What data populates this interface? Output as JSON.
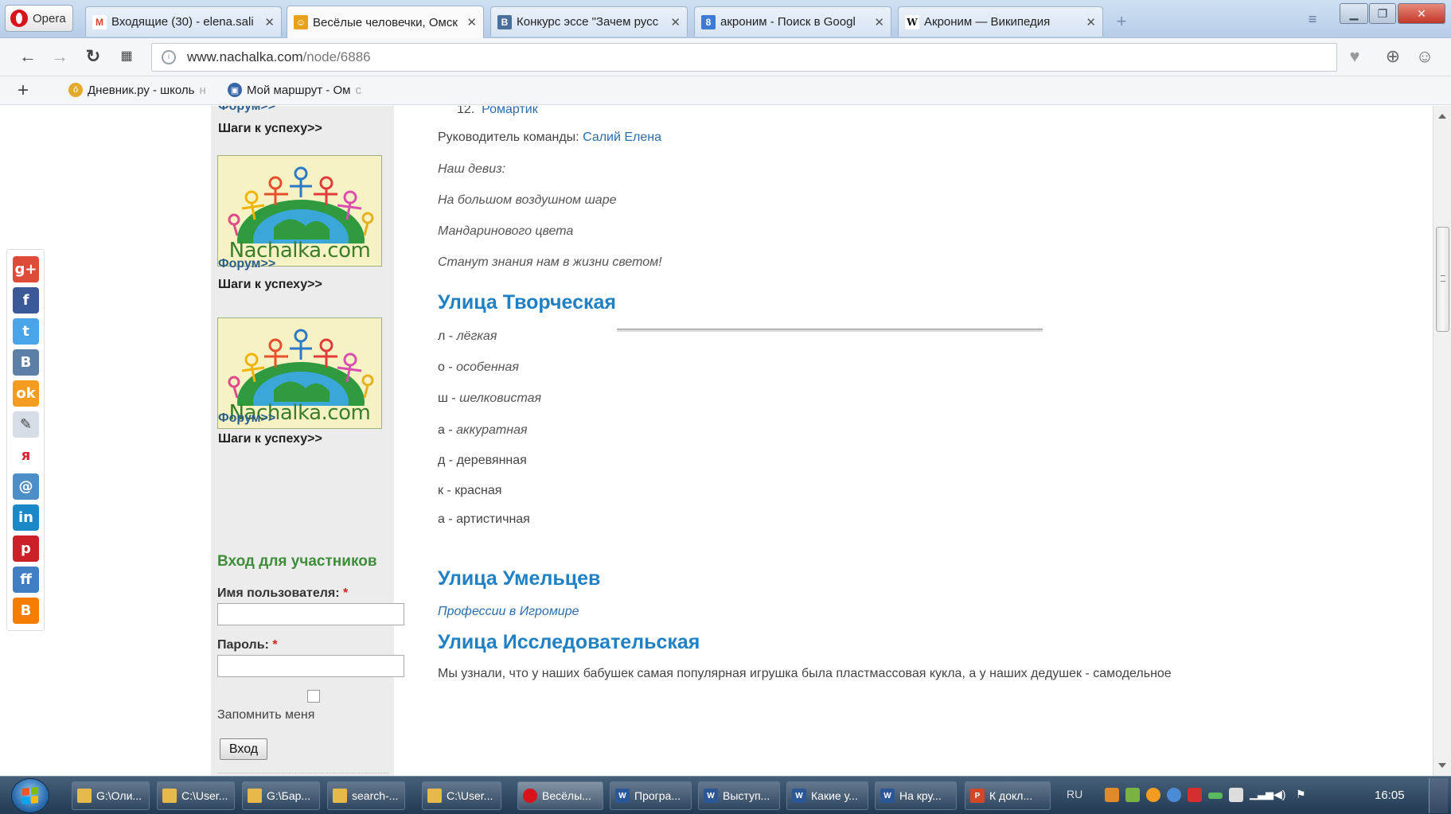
{
  "browser": {
    "menu_label": "Opera",
    "tabs": [
      {
        "title": "Входящие (30) - elena.sali",
        "favicon": "gmail-icon",
        "fav_glyph": "M",
        "fav_color": "#d64230"
      },
      {
        "title": "Весёлые человечки, Омск",
        "favicon": "nachalka-icon",
        "fav_glyph": "☺",
        "fav_color": "#e8a21a"
      },
      {
        "title": "Конкурс эссе \"Зачем русс",
        "favicon": "vk-icon",
        "fav_glyph": "В",
        "fav_color": "#4a6f9b"
      },
      {
        "title": "акроним - Поиск в Googl",
        "favicon": "google-icon",
        "fav_glyph": "8",
        "fav_color": "#3d7ad6"
      },
      {
        "title": "Акроним — Википедия",
        "favicon": "wikipedia-icon",
        "fav_glyph": "W",
        "fav_color": "#ffffff"
      }
    ],
    "address": {
      "domain": "www.nachalka.com",
      "path": "/node/6886"
    },
    "bookmarks": [
      {
        "label": "Дневник.ру - школь",
        "fade": "н"
      },
      {
        "label": "Мой маршрут - Ом",
        "fade": "с"
      }
    ]
  },
  "sidebar": {
    "forum_label": "Форум>>",
    "steps_label": "Шаги к успеху>>",
    "banner_text": "Nachalka.com",
    "login": {
      "title": "Вход для участников",
      "username_label": "Имя пользователя:",
      "password_label": "Пароль:",
      "required_mark": "*",
      "remember_label": "Запомнить меня",
      "submit_label": "Вход"
    }
  },
  "content": {
    "list_item_number": "12.",
    "list_item_label": "Ромартик",
    "leader_label": "Руководитель команды:",
    "leader_name": "Салий Елена",
    "motto_title": "Наш девиз:",
    "motto_lines": [
      "На большом воздушном шаре",
      "Мандаринового цвета",
      "Станут знания нам в жизни светом!"
    ],
    "street1_title": "Улица Творческая",
    "acrostic": [
      {
        "letter": "л",
        "word": "лёгкая",
        "italic": true
      },
      {
        "letter": "о",
        "word": "особенная",
        "italic": true
      },
      {
        "letter": "ш",
        "word": "шелковистая",
        "italic": true
      },
      {
        "letter": "а",
        "word": "аккуратная",
        "italic": true
      },
      {
        "letter": "д",
        "word": "деревянная",
        "italic": false
      },
      {
        "letter": "к",
        "word": "красная",
        "italic": false
      },
      {
        "letter": "а",
        "word": "артистичная",
        "italic": false
      }
    ],
    "street2_title": "Улица Умельцев",
    "street2_link": "Профессии в Игромире",
    "street3_title": "Улица Исследовательская",
    "street3_text": "Мы узнали, что у наших бабушек самая популярная игрушка была пластмассовая кукла, а у наших дедушек - самодельное"
  },
  "share": [
    "google-plus-icon",
    "facebook-icon",
    "twitter-icon",
    "vkontakte-icon",
    "odnoklassniki-icon",
    "livejournal-icon",
    "moikrug-icon",
    "mailru-icon",
    "linkedin-icon",
    "pinterest-icon",
    "friendfeed-icon",
    "blogger-icon"
  ],
  "taskbar": {
    "items": [
      {
        "label": "G:\\Оли...",
        "icon": "folder-icon"
      },
      {
        "label": "C:\\User...",
        "icon": "folder-icon"
      },
      {
        "label": "G:\\Бар...",
        "icon": "folder-icon"
      },
      {
        "label": "search-...",
        "icon": "folder-icon"
      },
      {
        "label": "C:\\User...",
        "icon": "folder-icon"
      },
      {
        "label": "Весёлы...",
        "icon": "opera-icon"
      },
      {
        "label": "Програ...",
        "icon": "word-icon"
      },
      {
        "label": "Выступ...",
        "icon": "word-icon"
      },
      {
        "label": "Какие у...",
        "icon": "word-icon"
      },
      {
        "label": "На кру...",
        "icon": "word-icon"
      },
      {
        "label": "К докл...",
        "icon": "powerpoint-icon"
      }
    ],
    "lang": "RU",
    "clock": "16:05"
  },
  "colors": {
    "link": "#2a6db0",
    "heading": "#1f80c3",
    "login_title": "#3f8d3a",
    "sidebar_bg": "#ececec"
  }
}
